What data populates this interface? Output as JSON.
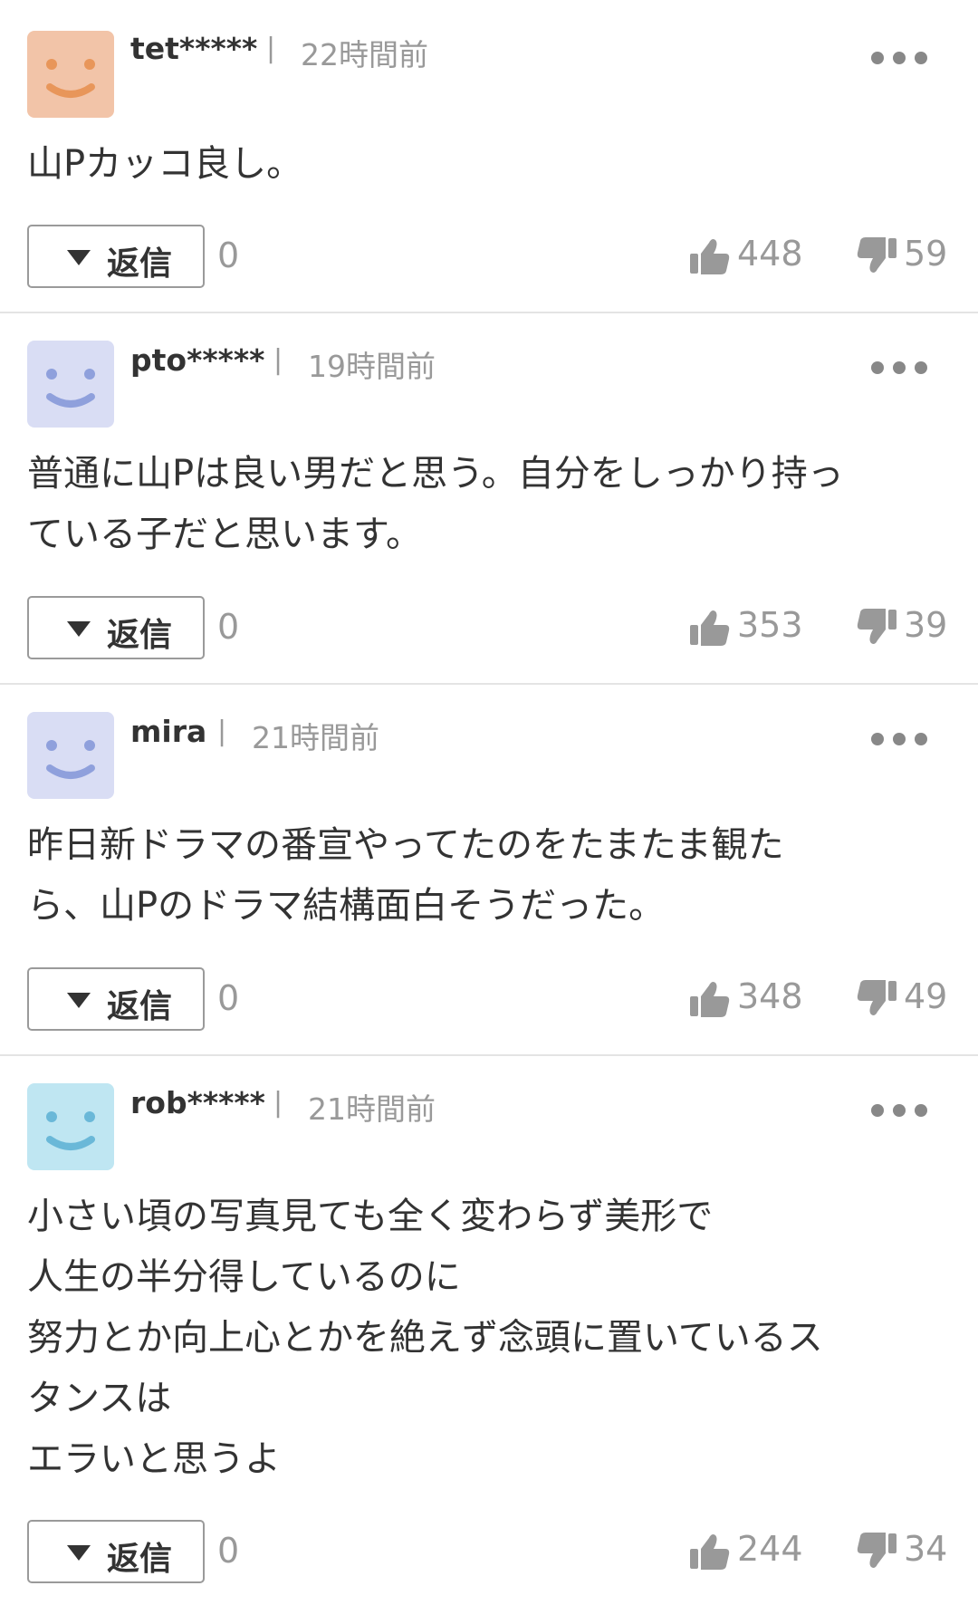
{
  "reply_label": "返信",
  "comments": [
    {
      "username": "tet*****",
      "time": "22時間前",
      "text": "山Pカッコ良し。",
      "reply_count": "0",
      "likes": "448",
      "dislikes": "59",
      "avatar_bg": "#f2c4a8",
      "avatar_fg": "#e8965a"
    },
    {
      "username": "pto*****",
      "time": "19時間前",
      "text": "普通に山Pは良い男だと思う。自分をしっかり持っ\nている子だと思います。",
      "reply_count": "0",
      "likes": "353",
      "dislikes": "39",
      "avatar_bg": "#d9ddf4",
      "avatar_fg": "#8fa0dc"
    },
    {
      "username": "mira",
      "time": "21時間前",
      "text": "昨日新ドラマの番宣やってたのをたまたま観た\nら、山Pのドラマ結構面白そうだった。",
      "reply_count": "0",
      "likes": "348",
      "dislikes": "49",
      "avatar_bg": "#d9ddf4",
      "avatar_fg": "#8fa0dc"
    },
    {
      "username": "rob*****",
      "time": "21時間前",
      "text": "小さい頃の写真見ても全く変わらず美形で\n人生の半分得しているのに\n努力とか向上心とかを絶えず念頭に置いているス\nタンスは\nエラいと思うよ",
      "reply_count": "0",
      "likes": "244",
      "dislikes": "34",
      "avatar_bg": "#bfe6f2",
      "avatar_fg": "#6ab8d8"
    }
  ]
}
